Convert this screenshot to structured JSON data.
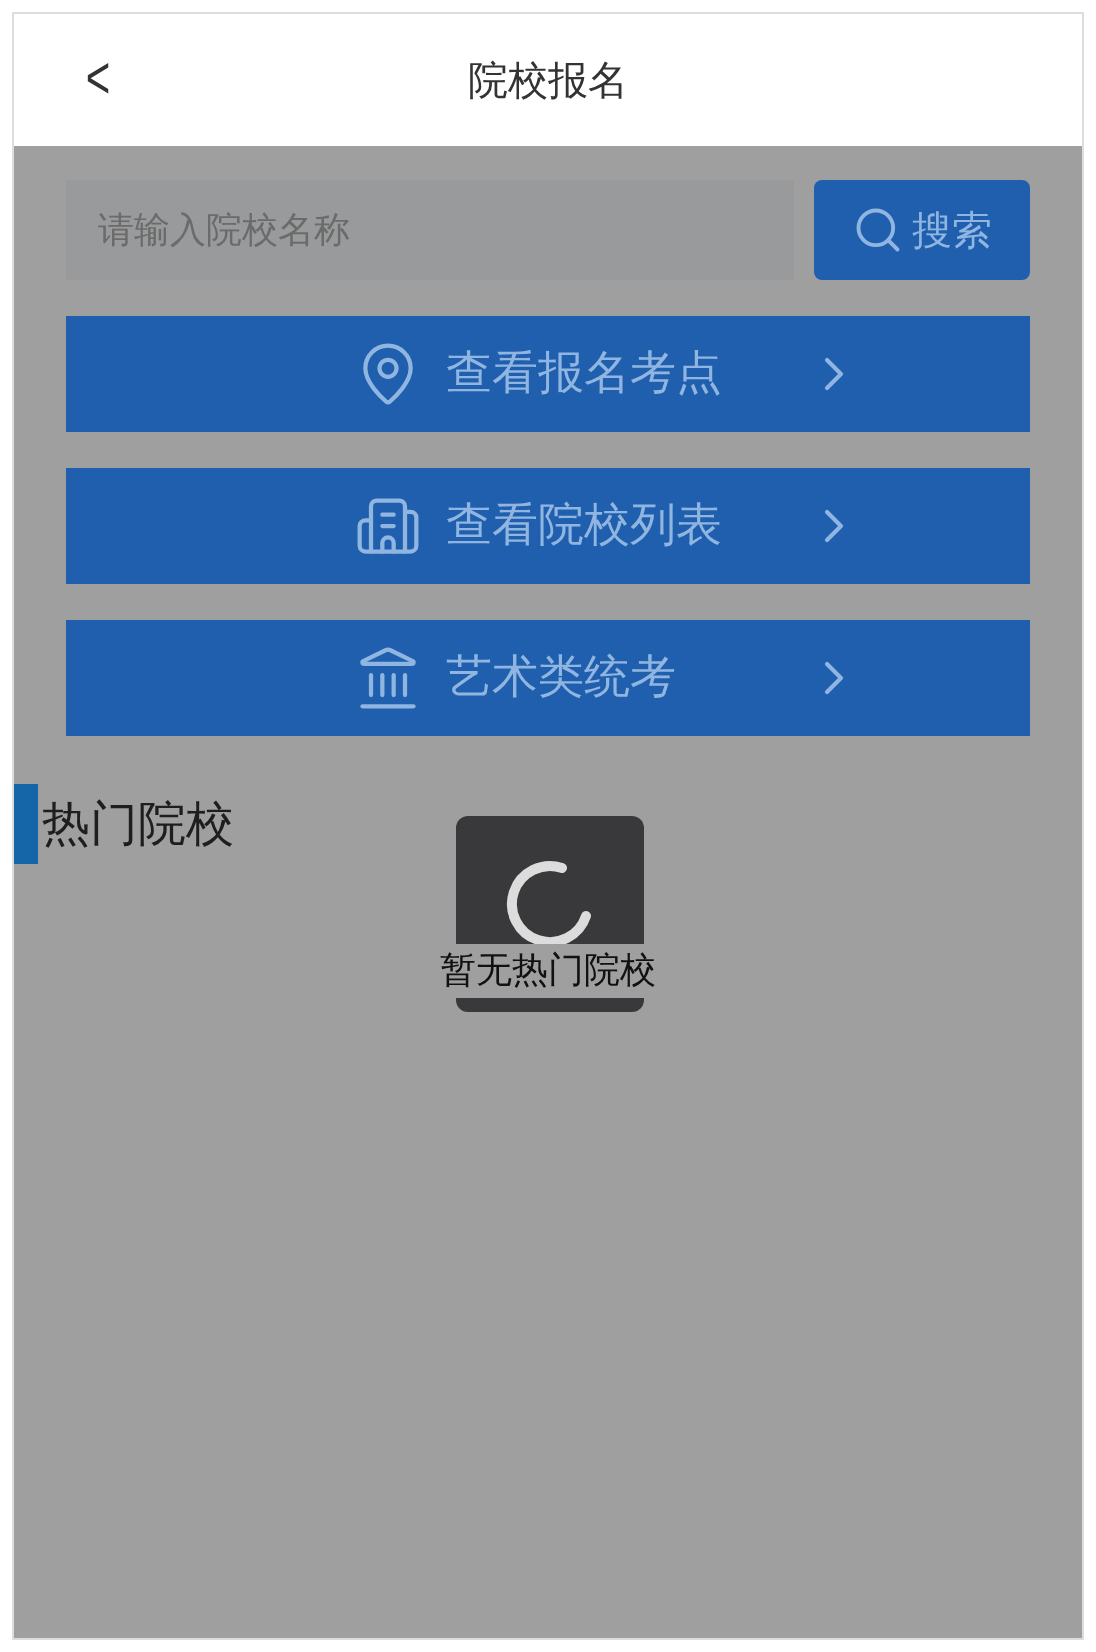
{
  "header": {
    "back": "<",
    "title": "院校报名"
  },
  "search": {
    "placeholder": "请输入院校名称",
    "button": "搜索"
  },
  "menu": [
    {
      "kind": "location",
      "label": "查看报名考点"
    },
    {
      "kind": "building",
      "label": "查看院校列表"
    },
    {
      "kind": "museum",
      "label": "艺术类统考"
    }
  ],
  "section": {
    "title": "热门院校",
    "empty_text": "暂无热门院校"
  },
  "loading": true
}
